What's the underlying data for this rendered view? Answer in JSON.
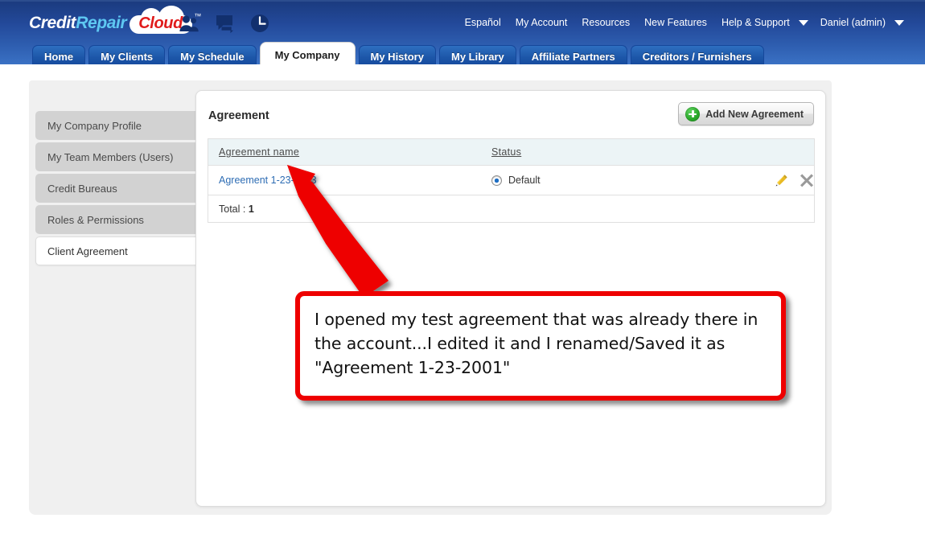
{
  "brand": {
    "logo_credit": "Credit",
    "logo_repair": "Repair",
    "logo_cloud": "Cloud",
    "logo_tm": "™",
    "header_gradient_from": "#1b3b7f",
    "header_gradient_to": "#3a71c4",
    "link_color": "#2e6db4",
    "accent_green": "#2cab2c",
    "annotation_red": "#ee0000"
  },
  "header": {
    "icons": [
      "users-icon",
      "chat-icon",
      "clock-icon"
    ],
    "topnav": [
      {
        "label": "Español",
        "caret": false
      },
      {
        "label": "My Account",
        "caret": false
      },
      {
        "label": "Resources",
        "caret": false
      },
      {
        "label": "New Features",
        "caret": false
      },
      {
        "label": "Help & Support",
        "caret": true
      },
      {
        "label": "Daniel (admin)",
        "caret": true
      }
    ]
  },
  "tabs": [
    {
      "label": "Home",
      "active": false
    },
    {
      "label": "My Clients",
      "active": false
    },
    {
      "label": "My Schedule",
      "active": false
    },
    {
      "label": "My Company",
      "active": true
    },
    {
      "label": "My History",
      "active": false
    },
    {
      "label": "My Library",
      "active": false
    },
    {
      "label": "Affiliate Partners",
      "active": false
    },
    {
      "label": "Creditors / Furnishers",
      "active": false
    }
  ],
  "sidebar": {
    "items": [
      {
        "label": "My Company Profile",
        "active": false
      },
      {
        "label": "My Team Members (Users)",
        "active": false
      },
      {
        "label": "Credit Bureaus",
        "active": false
      },
      {
        "label": "Roles & Permissions",
        "active": false
      },
      {
        "label": "Client Agreement",
        "active": true
      }
    ]
  },
  "main": {
    "card_title": "Agreement",
    "add_button_label": "Add New Agreement",
    "table": {
      "columns": [
        "Agreement name",
        "Status"
      ],
      "rows": [
        {
          "name": "Agreement 1-23-2013",
          "status_label": "Default",
          "status_selected": true,
          "edit_icon": "pencil-icon",
          "delete_icon": "close-x-icon"
        }
      ],
      "total_label": "Total :",
      "total_value": "1"
    }
  },
  "annotation": {
    "text": "I opened my test agreement that was already there in the account...I edited it and I renamed/Saved it as \"Agreement 1-23-2001\"",
    "arrow_from": "callout-top-left",
    "arrow_to": "agreement-name-link"
  }
}
